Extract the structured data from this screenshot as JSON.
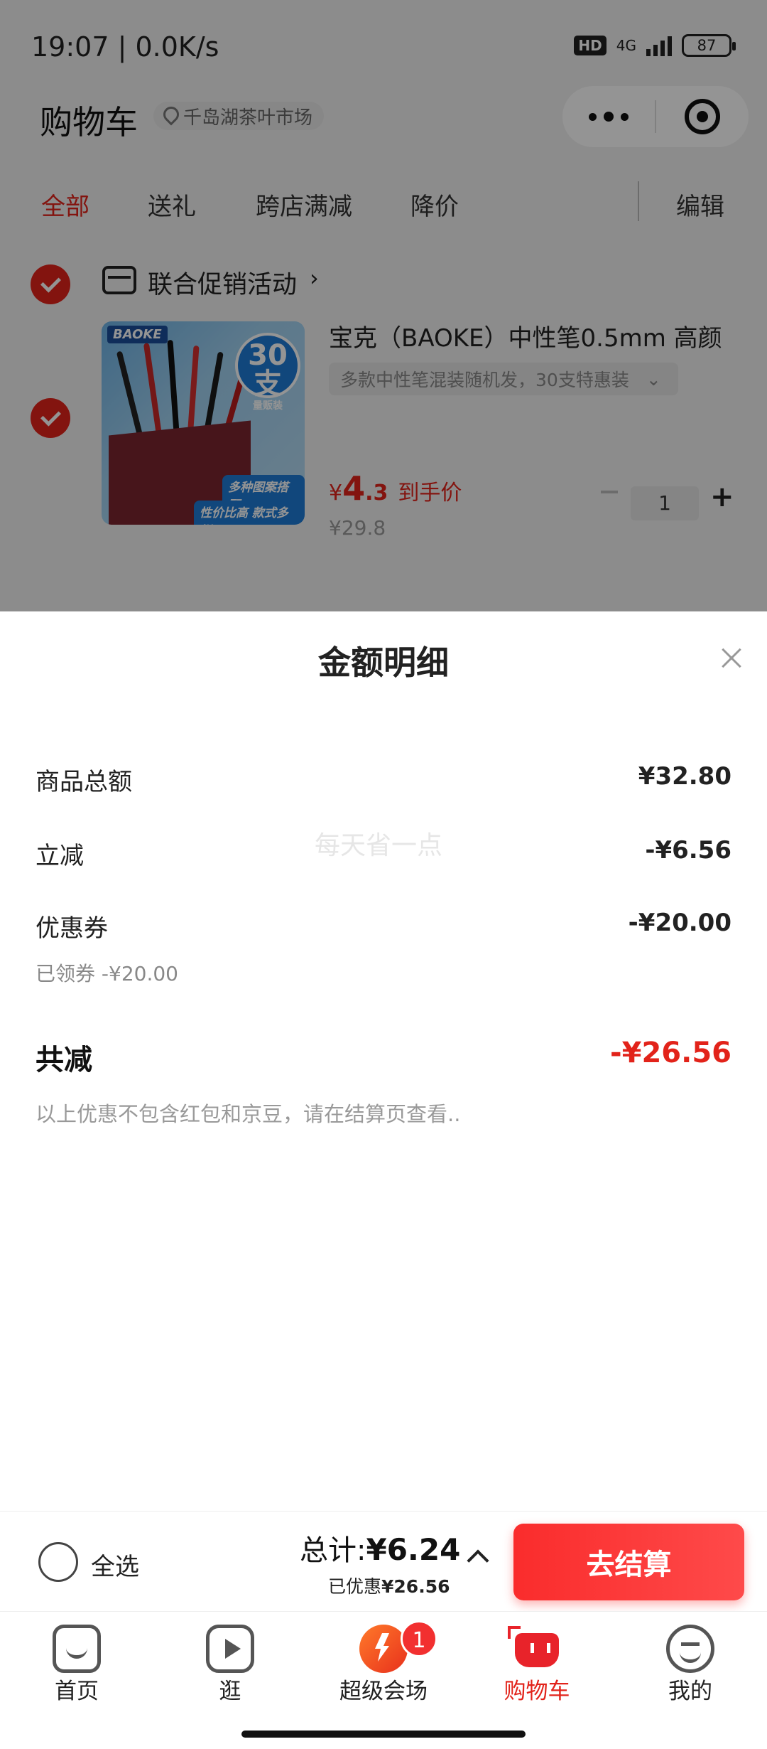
{
  "status_bar": {
    "time": "19:07 | 0.0K/s",
    "hd": "HD",
    "network": "4G",
    "battery": "87"
  },
  "nav": {
    "title": "购物车",
    "location": "千岛湖茶叶市场"
  },
  "filters": {
    "tabs": [
      "全部",
      "送礼",
      "跨店满减",
      "降价"
    ],
    "edit": "编辑",
    "active_index": 0
  },
  "shop": {
    "name": "联合促销活动",
    "chevron": "›"
  },
  "product": {
    "image_brand": "BAOKE",
    "image_badge_number": "30支",
    "image_badge_text": "量贩装",
    "image_tag_1": "多种图案搭配",
    "image_tag_2": "性价比高 款式多样",
    "title": "宝克（BAOKE）中性笔0.5mm 高颜",
    "spec": "多款中性笔混装随机发，30支特惠装",
    "price_symbol": "¥",
    "price_int": "4",
    "price_dec": ".3",
    "price_label": "到手价",
    "original_price": "¥29.8",
    "quantity": "1"
  },
  "sheet": {
    "title": "金额明细",
    "watermark": "每天省一点",
    "goods_total_label": "商品总额",
    "goods_total_value": "¥32.80",
    "instant_off_label": "立减",
    "instant_off_value": "-¥6.56",
    "coupon_label": "优惠券",
    "coupon_value": "-¥20.00",
    "coupon_note": "已领券 -¥20.00",
    "total_off_label": "共减",
    "total_off_value": "-¥26.56",
    "note": "以上优惠不包含红包和京豆，请在结算页查看.."
  },
  "checkout": {
    "select_all": "全选",
    "total_prefix": "总计:",
    "total_amount": "¥6.24",
    "saved_prefix": "已优惠",
    "saved_amount": "¥26.56",
    "button": "去结算"
  },
  "tabbar": {
    "items": [
      "首页",
      "逛",
      "超级会场",
      "购物车",
      "我的"
    ],
    "active_index": 3,
    "badge": "1"
  },
  "colors": {
    "accent_red": "#e2231a",
    "button_red": "#fa2c2c",
    "muted": "#999999"
  }
}
